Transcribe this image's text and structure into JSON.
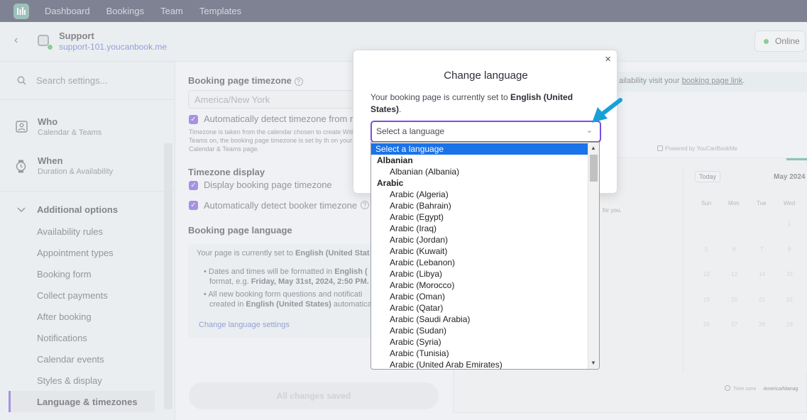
{
  "nav": {
    "items": [
      "Dashboard",
      "Bookings",
      "Team",
      "Templates"
    ]
  },
  "account": {
    "name": "Support",
    "url": "support-101.youcanbook.me",
    "status": "Online"
  },
  "sidebar": {
    "search_placeholder": "Search settings...",
    "who": {
      "title": "Who",
      "subtitle": "Calendar & Teams"
    },
    "when": {
      "title": "When",
      "subtitle": "Duration & Availability"
    },
    "additional_options": "Additional options",
    "items": [
      "Availability rules",
      "Appointment types",
      "Booking form",
      "Collect payments",
      "After booking",
      "Notifications",
      "Calendar events",
      "Styles & display",
      "Language & timezones"
    ],
    "active_item": "Language & timezones"
  },
  "main": {
    "timezone_label": "Booking page timezone",
    "timezone_value": "America/New York",
    "auto_detect_label": "Automatically detect timezone from r",
    "tz_help": "Timezone is taken from the calendar chosen to create With Teams on, the booking page timezone is set by th on your Calendar & Teams page.",
    "timezone_display_label": "Timezone display",
    "display_tz_label": "Display booking page timezone",
    "detect_booker_label": "Automatically detect booker timezone",
    "language_label": "Booking page language",
    "lang_box_line1_prefix": "Your page is currently set to",
    "lang_box_line1_bold": "English (United Stat",
    "bullet1_prefix": "Dates and times will be formatted in",
    "bullet1_bold": "English (",
    "bullet1_line2_prefix": "format, e.g.",
    "bullet1_line2_bold": "Friday, May 31st, 2024, 2:50 PM.",
    "bullet2_line1": "All new booking form questions and notificati",
    "bullet2_line2_prefix": "created in",
    "bullet2_line2_bold": "English (United States)",
    "bullet2_line2_suffix": "automatica",
    "change_link": "Change language settings",
    "save_button": "All changes saved",
    "info_banner_text": "ailability visit your",
    "info_banner_link": "booking page link",
    "info_banner_end": ".",
    "powered_by": "Powered by YouCanBookMe",
    "for_you": "for you.",
    "calendar": {
      "today": "Today",
      "month": "May 2024",
      "days": [
        "Sun",
        "Mon",
        "Tue",
        "Wed"
      ],
      "rows": [
        [
          "",
          "",
          "",
          "1"
        ],
        [
          "5",
          "6",
          "7",
          "8"
        ],
        [
          "12",
          "13",
          "14",
          "15"
        ],
        [
          "19",
          "20",
          "21",
          "22"
        ],
        [
          "26",
          "27",
          "28",
          "29"
        ]
      ],
      "tz_label": "Time zone",
      "tz_value": "America/Manag"
    }
  },
  "modal": {
    "title": "Change language",
    "desc_prefix": "Your booking page is currently set to",
    "desc_bold": "English (United States)",
    "desc_suffix": ".",
    "select_placeholder": "Select a language",
    "close": "×"
  },
  "dropdown": {
    "rows": [
      {
        "type": "sel",
        "text": "Select a language"
      },
      {
        "type": "group",
        "text": "Albanian"
      },
      {
        "type": "opt",
        "text": "Albanian (Albania)"
      },
      {
        "type": "group",
        "text": "Arabic"
      },
      {
        "type": "opt",
        "text": "Arabic (Algeria)"
      },
      {
        "type": "opt",
        "text": "Arabic (Bahrain)"
      },
      {
        "type": "opt",
        "text": "Arabic (Egypt)"
      },
      {
        "type": "opt",
        "text": "Arabic (Iraq)"
      },
      {
        "type": "opt",
        "text": "Arabic (Jordan)"
      },
      {
        "type": "opt",
        "text": "Arabic (Kuwait)"
      },
      {
        "type": "opt",
        "text": "Arabic (Lebanon)"
      },
      {
        "type": "opt",
        "text": "Arabic (Libya)"
      },
      {
        "type": "opt",
        "text": "Arabic (Morocco)"
      },
      {
        "type": "opt",
        "text": "Arabic (Oman)"
      },
      {
        "type": "opt",
        "text": "Arabic (Qatar)"
      },
      {
        "type": "opt",
        "text": "Arabic (Saudi Arabia)"
      },
      {
        "type": "opt",
        "text": "Arabic (Sudan)"
      },
      {
        "type": "opt",
        "text": "Arabic (Syria)"
      },
      {
        "type": "opt",
        "text": "Arabic (Tunisia)"
      },
      {
        "type": "opt",
        "text": "Arabic (United Arab Emirates)"
      }
    ]
  },
  "colors": {
    "accent": "#6d47d9",
    "nav_bg": "#262b45",
    "arrow": "#1aa0d8",
    "highlight": "#1a73e8"
  }
}
